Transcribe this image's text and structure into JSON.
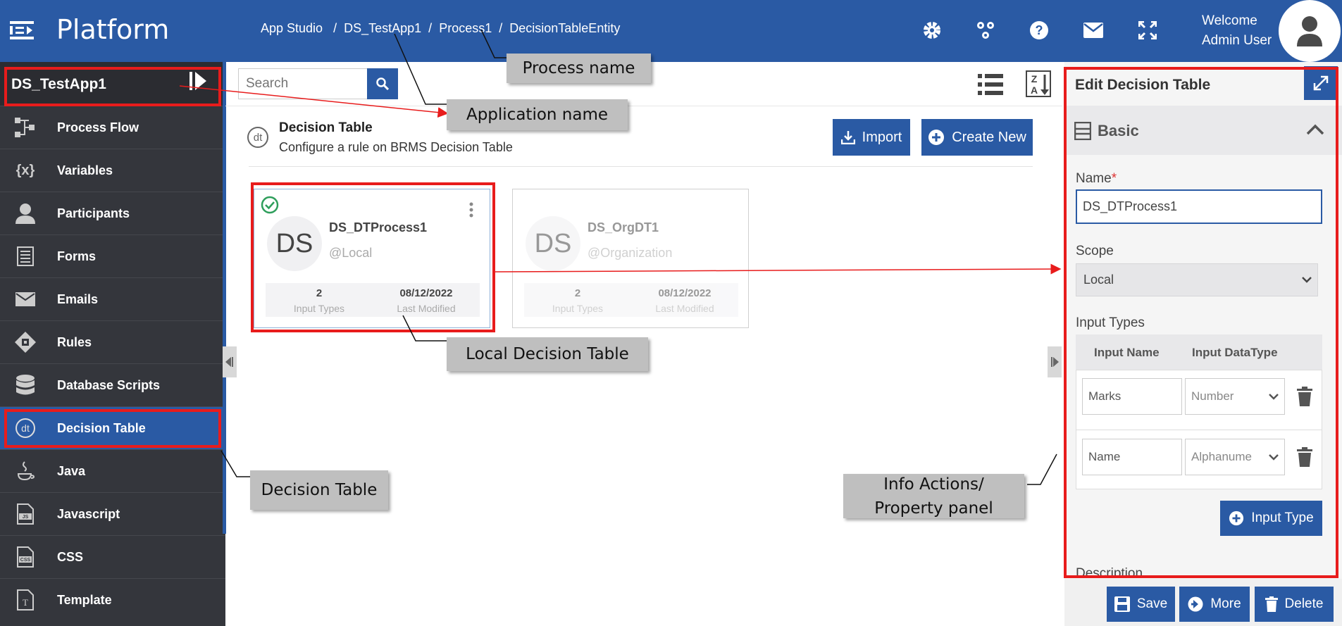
{
  "header": {
    "brand": "Platform",
    "breadcrumb": [
      "App Studio",
      "DS_TestApp1",
      "Process1",
      "DecisionTableEntity"
    ],
    "welcome_line1": "Welcome",
    "welcome_line2": "Admin User",
    "icons": [
      "gear-icon",
      "hierarchy-icon",
      "help-icon",
      "mail-icon",
      "fullscreen-icon",
      "user-icon"
    ]
  },
  "sidebar": {
    "app_name": "DS_TestApp1",
    "items": [
      {
        "label": "Process Flow",
        "icon": "process-flow-icon"
      },
      {
        "label": "Variables",
        "icon": "variables-icon"
      },
      {
        "label": "Participants",
        "icon": "participants-icon"
      },
      {
        "label": "Forms",
        "icon": "forms-icon"
      },
      {
        "label": "Emails",
        "icon": "emails-icon"
      },
      {
        "label": "Rules",
        "icon": "rules-icon"
      },
      {
        "label": "Database Scripts",
        "icon": "database-icon"
      },
      {
        "label": "Decision Table",
        "icon": "decision-table-icon",
        "active": true
      },
      {
        "label": "Java",
        "icon": "java-icon"
      },
      {
        "label": "Javascript",
        "icon": "javascript-icon"
      },
      {
        "label": "CSS",
        "icon": "css-icon"
      },
      {
        "label": "Template",
        "icon": "template-icon"
      }
    ]
  },
  "main": {
    "search_placeholder": "Search",
    "section_title": "Decision Table",
    "section_subtitle": "Configure a rule on BRMS Decision Table",
    "import_label": "Import",
    "create_label": "Create New",
    "cards": [
      {
        "initials": "DS",
        "title": "DS_DTProcess1",
        "scope": "@Local",
        "count": "2",
        "count_label": "Input Types",
        "date": "08/12/2022",
        "date_label": "Last Modified",
        "selected": true
      },
      {
        "initials": "DS",
        "title": "DS_OrgDT1",
        "scope": "@Organization",
        "count": "2",
        "count_label": "Input Types",
        "date": "08/12/2022",
        "date_label": "Last Modified",
        "selected": false
      }
    ]
  },
  "panel": {
    "title": "Edit Decision Table",
    "section": "Basic",
    "name_label": "Name",
    "name_required": "*",
    "name_value": "DS_DTProcess1",
    "scope_label": "Scope",
    "scope_value": "Local",
    "input_types_label": "Input Types",
    "col_name": "Input Name",
    "col_type": "Input DataType",
    "rows": [
      {
        "name": "Marks",
        "type": "Number"
      },
      {
        "name": "Name",
        "type": "Alphanume"
      }
    ],
    "add_input_label": "Input Type",
    "description_label": "Description",
    "save_label": "Save",
    "more_label": "More",
    "delete_label": "Delete"
  },
  "annotations": {
    "process_name": "Process name",
    "application_name": "Application name",
    "local_decision_table": "Local Decision Table",
    "decision_table": "Decision Table",
    "info_line1": "Info Actions/",
    "info_line2": "Property panel",
    "accent_color": "#e81c1c"
  }
}
